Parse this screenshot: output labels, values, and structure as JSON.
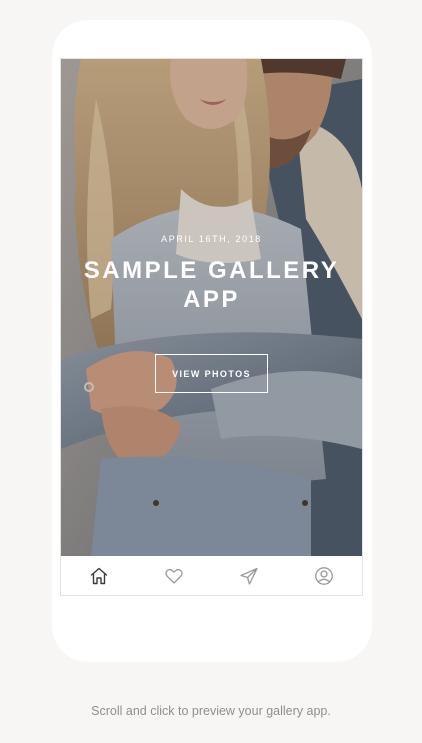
{
  "gallery": {
    "date": "APRIL 16TH, 2018",
    "title": "SAMPLE GALLERY APP",
    "view_button": "VIEW PHOTOS"
  },
  "tabbar": {
    "tabs": [
      {
        "icon": "home-icon",
        "active": true
      },
      {
        "icon": "heart-icon",
        "active": false
      },
      {
        "icon": "send-icon",
        "active": false
      },
      {
        "icon": "user-icon",
        "active": false
      }
    ]
  },
  "caption": "Scroll and click to preview your gallery app.",
  "colors": {
    "page_background": "#f8f6f4",
    "phone_background": "#ffffff",
    "active_icon": "#3a3a3a",
    "inactive_icon": "#9a9a9a",
    "caption_text": "#8f8f8f"
  }
}
